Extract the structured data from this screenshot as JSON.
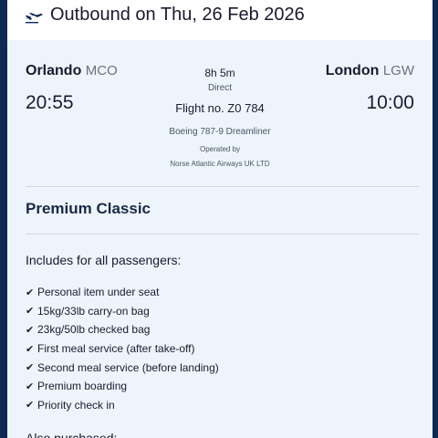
{
  "header": {
    "title": "Outbound on Thu, 26 Feb 2026",
    "icon": "plane-departure-icon"
  },
  "flight": {
    "origin": {
      "city": "Orlando",
      "code": "MCO",
      "time": "20:55"
    },
    "destination": {
      "city": "London",
      "code": "LGW",
      "time": "10:00"
    },
    "duration": "8h 5m",
    "stops": "Direct",
    "flight_number": "Flight no. Z0 784",
    "aircraft": "Boeing 787-9 Dreamliner",
    "operated_by_label": "Operated by",
    "operator": "Norse Atlantic Airways UK LTD"
  },
  "fare": {
    "class": "Premium Classic",
    "includes_heading": "Includes for all passengers:",
    "check_glyph": "✔",
    "inclusions": [
      "Personal item under seat",
      "15kg/33lb carry-on bag",
      "23kg/50lb checked bag",
      "First meal service (after take-off)",
      "Second meal service (before landing)",
      "Premium boarding",
      "Priority check in"
    ],
    "also_purchased_heading": "Also purchased:"
  },
  "colors": {
    "accent": "#0f2a52",
    "panel": "#eef4fb"
  }
}
